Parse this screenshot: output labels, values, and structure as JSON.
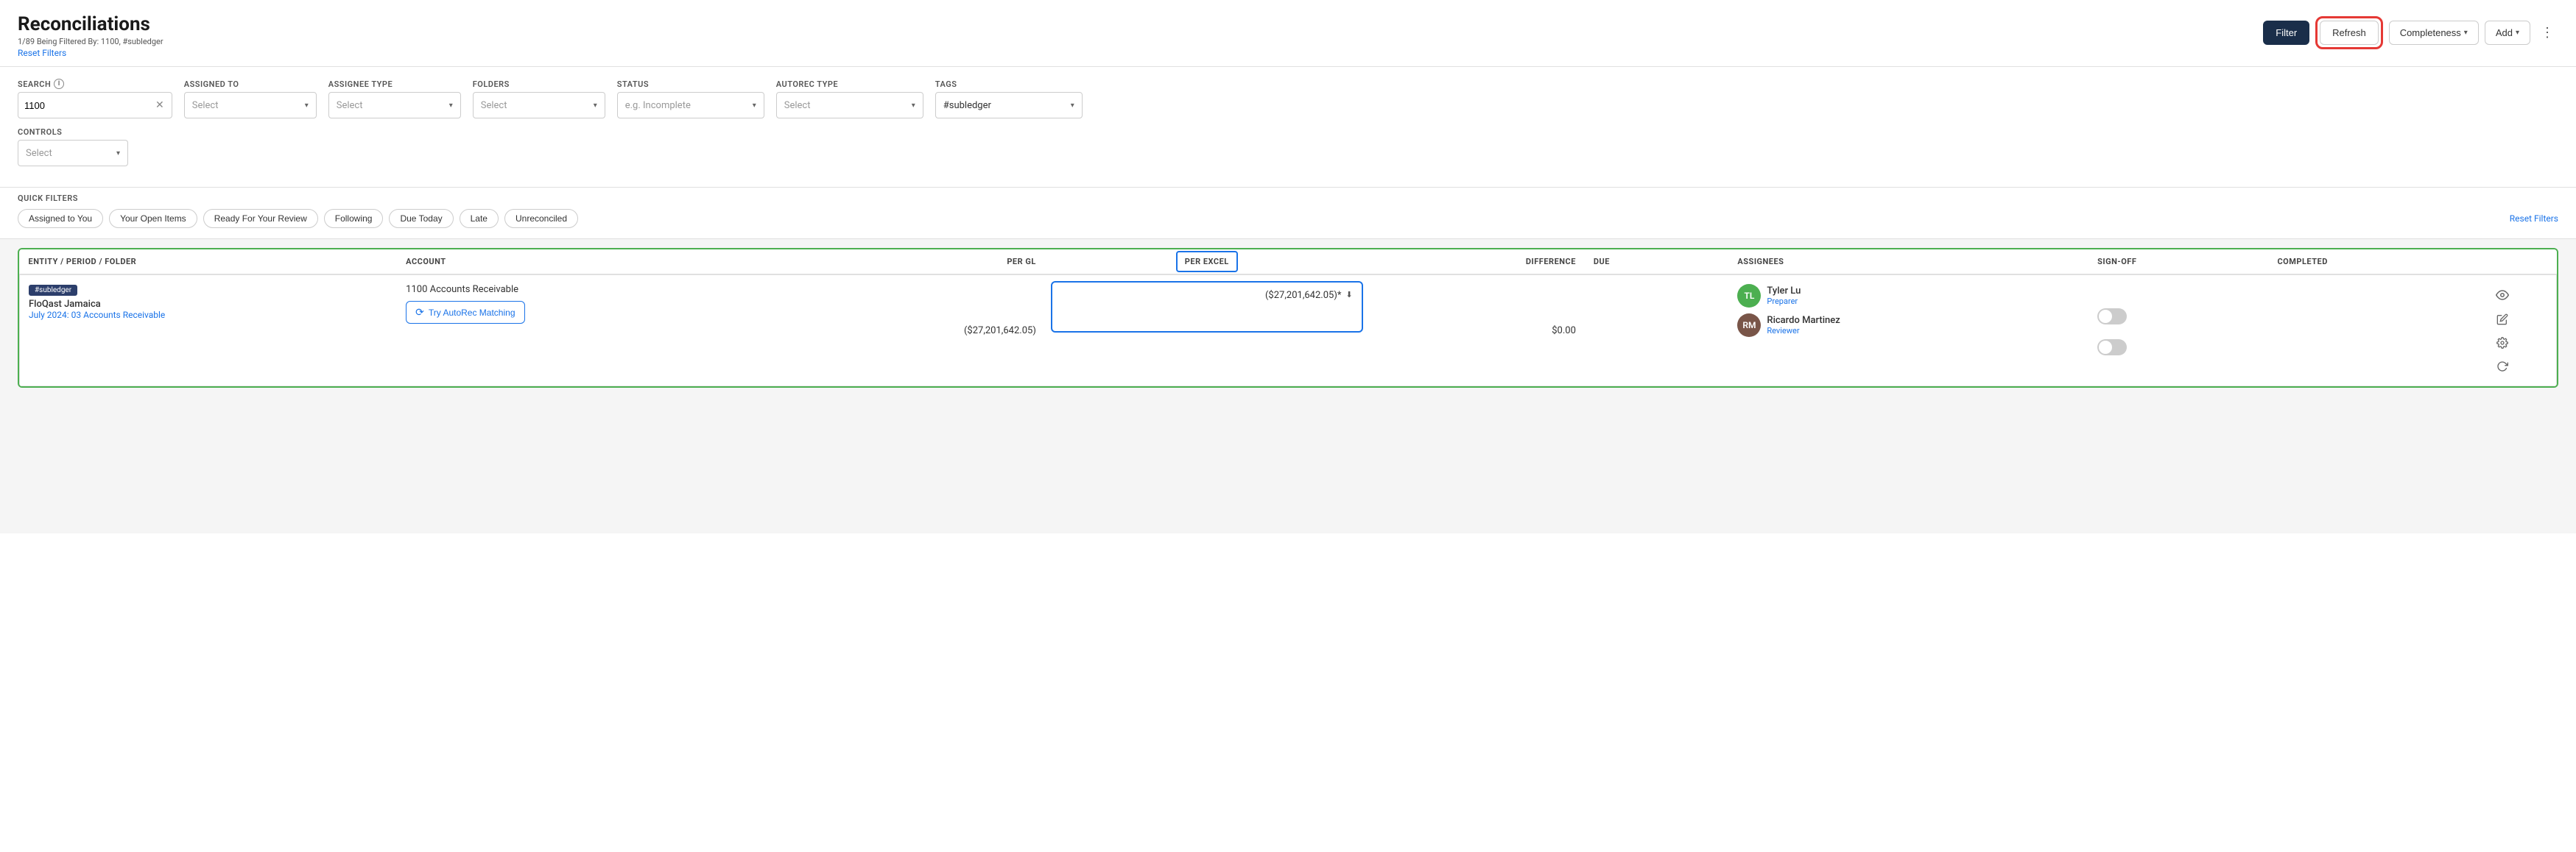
{
  "header": {
    "title": "Reconciliations",
    "filter_info": "1/89 Being Filtered By: 1100, #subledger",
    "reset_filters_label": "Reset Filters"
  },
  "toolbar": {
    "filter_label": "Filter",
    "refresh_label": "Refresh",
    "completeness_label": "Completeness",
    "add_label": "Add",
    "more_icon": "⋮"
  },
  "filters": {
    "search_label": "SEARCH",
    "search_value": "1100",
    "assigned_to_label": "ASSIGNED TO",
    "assigned_to_placeholder": "Select",
    "assignee_type_label": "ASSIGNEE TYPE",
    "assignee_type_placeholder": "Select",
    "folders_label": "FOLDERS",
    "folders_placeholder": "Select",
    "status_label": "STATUS",
    "status_placeholder": "e.g. Incomplete",
    "autorec_type_label": "AUTOREC TYPE",
    "autorec_type_placeholder": "Select",
    "tags_label": "TAGS",
    "tags_value": "#subledger",
    "controls_label": "CONTROLS",
    "controls_placeholder": "Select"
  },
  "quick_filters": {
    "label": "QUICK FILTERS",
    "buttons": [
      "Assigned to You",
      "Your Open Items",
      "Ready For Your Review",
      "Following",
      "Due Today",
      "Late",
      "Unreconciled"
    ],
    "reset_label": "Reset Filters"
  },
  "table": {
    "columns": [
      "ENTITY / PERIOD / FOLDER",
      "ACCOUNT",
      "PER GL",
      "PER EXCEL",
      "DIFFERENCE",
      "DUE",
      "ASSIGNEES",
      "SIGN-OFF",
      "COMPLETED"
    ],
    "rows": [
      {
        "tag": "#subledger",
        "entity": "FloQast Jamaica",
        "period_folder": "July 2024: 03 Accounts Receivable",
        "account_name": "1100 Accounts Receivable",
        "autorec_btn_label": "Try AutoRec Matching",
        "per_gl": "($27,201,642.05)",
        "per_excel": "($27,201,642.05)*",
        "difference": "$0.00",
        "due": "",
        "assignees": [
          {
            "initials": "TL",
            "name": "Tyler Lu",
            "role": "Preparer",
            "type": "initials"
          },
          {
            "initials": "RM",
            "name": "Ricardo Martinez",
            "role": "Reviewer",
            "type": "image"
          }
        ]
      }
    ]
  },
  "icons": {
    "chevron_down": "▾",
    "clear": "✕",
    "info": "i",
    "download": "⬇",
    "eye": "👁",
    "edit": "✏",
    "gear": "⚙",
    "autorec": "⟳",
    "more_vert": "⋮"
  }
}
